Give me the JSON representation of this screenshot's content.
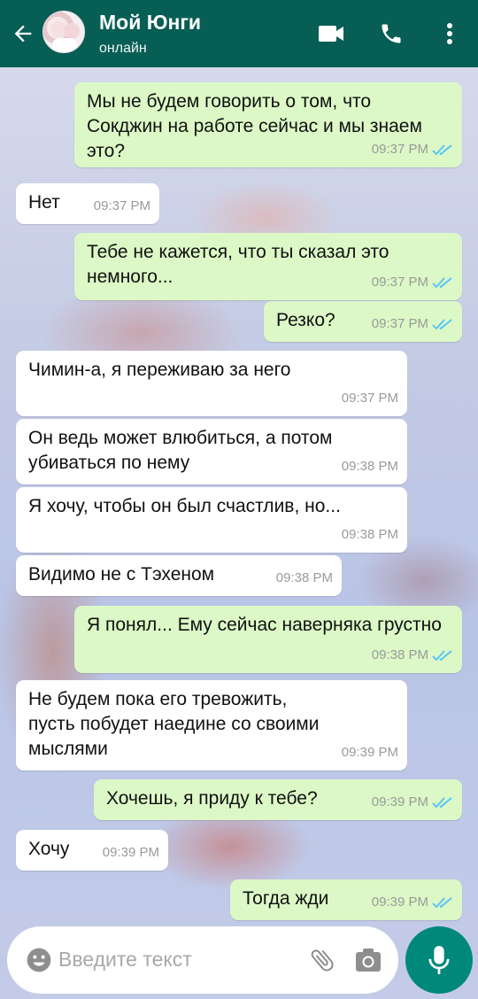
{
  "header": {
    "contact_name": "Мой Юнги",
    "status": "онлайн",
    "icons": [
      "back-arrow-icon",
      "avatar",
      "video-call-icon",
      "phone-icon",
      "more-vert-icon"
    ],
    "colors": {
      "bar": "#075e54",
      "outgoing": "#dcf8c6",
      "incoming": "#ffffff",
      "tick_read": "#4fc3f7"
    }
  },
  "messages": [
    {
      "dir": "out",
      "text": "Мы не будем говорить о том, что Сокджин на работе сейчас и мы знаем это?",
      "time": "09:37 PM",
      "read": true
    },
    {
      "dir": "in",
      "text": "Нет",
      "time": "09:37 PM"
    },
    {
      "dir": "out",
      "text": "Тебе не кажется, что ты сказал это немного...",
      "time": "09:37 PM",
      "read": true
    },
    {
      "dir": "out",
      "text": "Резко?",
      "time": "09:37 PM",
      "read": true
    },
    {
      "dir": "in",
      "text": "Чимин-а, я переживаю за него",
      "time": "09:37 PM"
    },
    {
      "dir": "in",
      "text": "Он ведь может влюбиться, а потом убиваться по нему",
      "time": "09:38 PM"
    },
    {
      "dir": "in",
      "text": "Я хочу, чтобы он был счастлив, но...",
      "time": "09:38 PM"
    },
    {
      "dir": "in",
      "text": "Видимо не с Тэхеном",
      "time": "09:38 PM"
    },
    {
      "dir": "out",
      "text": "Я понял... Ему сейчас наверняка грустно",
      "time": "09:38 PM",
      "read": true
    },
    {
      "dir": "in",
      "text": "Не будем пока его тревожить, пусть побудет наедине со своими мыслями",
      "time": "09:39 PM"
    },
    {
      "dir": "out",
      "text": "Хочешь, я приду к тебе?",
      "time": "09:39 PM",
      "read": true
    },
    {
      "dir": "in",
      "text": "Хочу",
      "time": "09:39 PM"
    },
    {
      "dir": "out",
      "text": "Тогда жди",
      "time": "09:39 PM",
      "read": true
    }
  ],
  "composer": {
    "placeholder": "Введите текст",
    "icons": [
      "emoji-icon",
      "attach-icon",
      "camera-icon",
      "mic-icon"
    ]
  }
}
